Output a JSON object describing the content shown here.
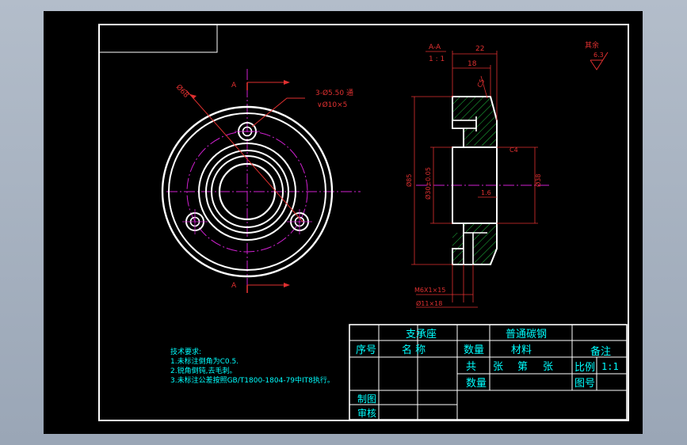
{
  "colors": {
    "background": "#000000",
    "frame": "#ffffff",
    "center_line": "#d020d0",
    "dimension": "#e03030",
    "title_text": "#00ffff",
    "hatch": "#20c040",
    "viewport": "#a9b4c2"
  },
  "section_view": {
    "label": "A-A",
    "scale": "1 : 1"
  },
  "plan_view": {
    "cut_marker_top": "A",
    "cut_marker_bottom": "A",
    "hole_note_line1": "3-Ø5.50 通",
    "hole_note_line2": "∨Ø10×5",
    "bolt_circle_dim": "Ø68"
  },
  "dimensions": {
    "width_top": "22",
    "width_inner": "18",
    "chamfer_top": "C5",
    "chamfer_mid": "C4",
    "outer_dia": "Ø85",
    "bore_dia": "Ø30±0.05",
    "right_dia": "Ø38",
    "step": "1.6",
    "thread": "M6X1×15",
    "counterbore": "Ø11×18"
  },
  "roughness": {
    "label": "其余",
    "value": "6.3"
  },
  "tech_notes": {
    "title": "技术要求:",
    "items": [
      "1.未标注倒角为C0.5.",
      "2.锐角倒钝,去毛刺。",
      "3.未标注公差按照GB/T1800-1804-79中IT8执行。"
    ]
  },
  "title_block": {
    "part_name": "支承座",
    "material": "普通碳钢",
    "col_seq": "序号",
    "col_name": "名  称",
    "col_qty": "数量",
    "col_material": "材料",
    "col_note": "备注",
    "total": "共",
    "sheet_unit1": "张",
    "sheet_no": "第",
    "sheet_unit2": "张",
    "scale_label": "比例",
    "scale_value": "1:1",
    "qty_label": "数量",
    "drawing_no_label": "图号",
    "drawn_by": "制图",
    "checked_by": "审核"
  }
}
